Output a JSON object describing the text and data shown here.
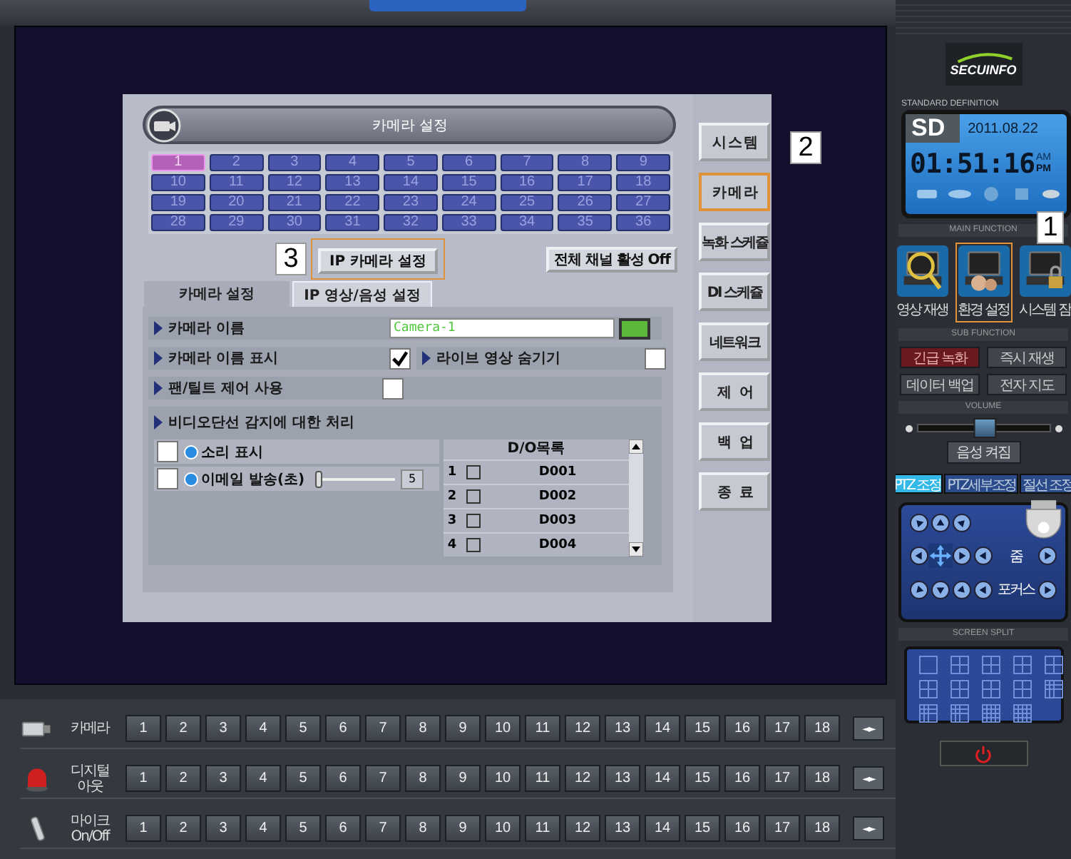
{
  "dialog": {
    "title": "카메라 설정",
    "channels": [
      {
        "label": "1",
        "selected": true
      },
      {
        "label": "2",
        "selected": false
      },
      {
        "label": "3",
        "selected": false
      },
      {
        "label": "4",
        "selected": false
      },
      {
        "label": "5",
        "selected": false
      },
      {
        "label": "6",
        "selected": false
      },
      {
        "label": "7",
        "selected": false
      },
      {
        "label": "8",
        "selected": false
      },
      {
        "label": "9",
        "selected": false
      },
      {
        "label": "10",
        "selected": false
      },
      {
        "label": "11",
        "selected": false
      },
      {
        "label": "12",
        "selected": false
      },
      {
        "label": "13",
        "selected": false
      },
      {
        "label": "14",
        "selected": false
      },
      {
        "label": "15",
        "selected": false
      },
      {
        "label": "16",
        "selected": false
      },
      {
        "label": "17",
        "selected": false
      },
      {
        "label": "18",
        "selected": false
      },
      {
        "label": "19",
        "selected": false
      },
      {
        "label": "20",
        "selected": false
      },
      {
        "label": "21",
        "selected": false
      },
      {
        "label": "22",
        "selected": false
      },
      {
        "label": "23",
        "selected": false
      },
      {
        "label": "24",
        "selected": false
      },
      {
        "label": "25",
        "selected": false
      },
      {
        "label": "26",
        "selected": false
      },
      {
        "label": "27",
        "selected": false
      },
      {
        "label": "28",
        "selected": false
      },
      {
        "label": "29",
        "selected": false
      },
      {
        "label": "30",
        "selected": false
      },
      {
        "label": "31",
        "selected": false
      },
      {
        "label": "32",
        "selected": false
      },
      {
        "label": "33",
        "selected": false
      },
      {
        "label": "34",
        "selected": false
      },
      {
        "label": "35",
        "selected": false
      },
      {
        "label": "36",
        "selected": false
      }
    ],
    "callout": "3",
    "ip_camera_button": {
      "label": "IP 카메라 설정",
      "highlighted": true
    },
    "all_channels_button": "전체 채널 활성 Off",
    "tabs": [
      {
        "label": "카메라 설정",
        "selected": true
      },
      {
        "label": "IP 영상/음성 설정",
        "selected": false
      }
    ],
    "camera_name": {
      "label": "카메라 이름",
      "value": "Camera-1",
      "color": "#5cb83a"
    },
    "settings": [
      {
        "label": "카메라 이름 표시",
        "checked": true
      },
      {
        "label": "라이브 영상 숨기기",
        "checked": false
      },
      {
        "label": "팬/틸트 제어 사용",
        "checked": false
      }
    ],
    "video_loss": {
      "title": "비디오단선 감지에 대한 처리",
      "options": [
        {
          "kind": "check",
          "label": "소리 표시",
          "checked": false
        },
        {
          "kind": "slider",
          "label": "이메일 발송(초)",
          "checked": false,
          "level": 0,
          "value": "5"
        }
      ],
      "do_list": {
        "heading": "D/O목록",
        "rows": [
          {
            "index": "1",
            "checked": false,
            "name": "D001"
          },
          {
            "index": "2",
            "checked": false,
            "name": "D002"
          },
          {
            "index": "3",
            "checked": false,
            "name": "D003"
          },
          {
            "index": "4",
            "checked": false,
            "name": "D004"
          }
        ]
      }
    }
  },
  "menu": {
    "callout": "2",
    "items": [
      {
        "label": "시 스 템",
        "selected": false
      },
      {
        "label": "카 메 라",
        "selected": true
      },
      {
        "label": "녹화 스케쥴",
        "selected": false
      },
      {
        "label": "DI 스케쥴",
        "selected": false
      },
      {
        "label": "네트워크",
        "selected": false
      },
      {
        "label": "제   어",
        "selected": false
      },
      {
        "label": "백   업",
        "selected": false
      },
      {
        "label": "종   료",
        "selected": false
      }
    ]
  },
  "bottom_bar": {
    "rows": [
      {
        "kind": "camera",
        "label": "카메라",
        "buttons": [
          "1",
          "2",
          "3",
          "4",
          "5",
          "6",
          "7",
          "8",
          "9",
          "10",
          "11",
          "12",
          "13",
          "14",
          "15",
          "16",
          "17",
          "18"
        ],
        "arrows": "◄►"
      },
      {
        "kind": "output",
        "label": "디지털 아웃",
        "buttons": [
          "1",
          "2",
          "3",
          "4",
          "5",
          "6",
          "7",
          "8",
          "9",
          "10",
          "11",
          "12",
          "13",
          "14",
          "15",
          "16",
          "17",
          "18"
        ],
        "arrows": "◄►"
      },
      {
        "kind": "mic",
        "label": "마이크 On/Off",
        "buttons": [
          "1",
          "2",
          "3",
          "4",
          "5",
          "6",
          "7",
          "8",
          "9",
          "10",
          "11",
          "12",
          "13",
          "14",
          "15",
          "16",
          "17",
          "18"
        ],
        "arrows": "◄►"
      }
    ]
  },
  "side_panel": {
    "logo": "SECUINFO",
    "definition_label": "STANDARD DEFINITION",
    "mode": "SD",
    "date": "2011.08.22",
    "time": "01:51:16",
    "am": "AM",
    "pm": "PM",
    "main_function": {
      "heading": "MAIN FUNCTION",
      "callout": "1",
      "items": [
        {
          "kind": "playback",
          "label": "영상 재생",
          "selected": false
        },
        {
          "kind": "settings",
          "label": "환경 설정",
          "selected": true
        },
        {
          "kind": "lock",
          "label": "시스템 잠",
          "selected": false
        }
      ]
    },
    "sub_function": {
      "heading": "SUB FUNCTION",
      "buttons": [
        {
          "kind": "alert",
          "label": "긴급 녹화"
        },
        {
          "kind": "normal",
          "label": "즉시 재생"
        },
        {
          "kind": "normal",
          "label": "데이터 백업"
        },
        {
          "kind": "normal",
          "label": "전자 지도"
        }
      ]
    },
    "volume": {
      "heading": "VOLUME",
      "level": 0.52,
      "audio_button": "음성 켜짐"
    },
    "ptz": {
      "tabs": [
        {
          "label": "PTZ 조정",
          "selected": true
        },
        {
          "label": "PTZ세부조정",
          "selected": false
        },
        {
          "label": "절선 조정",
          "selected": false
        }
      ],
      "zoom_label": "줌",
      "focus_label": "포커스"
    },
    "screen_split": {
      "heading": "SCREEN SPLIT"
    }
  }
}
